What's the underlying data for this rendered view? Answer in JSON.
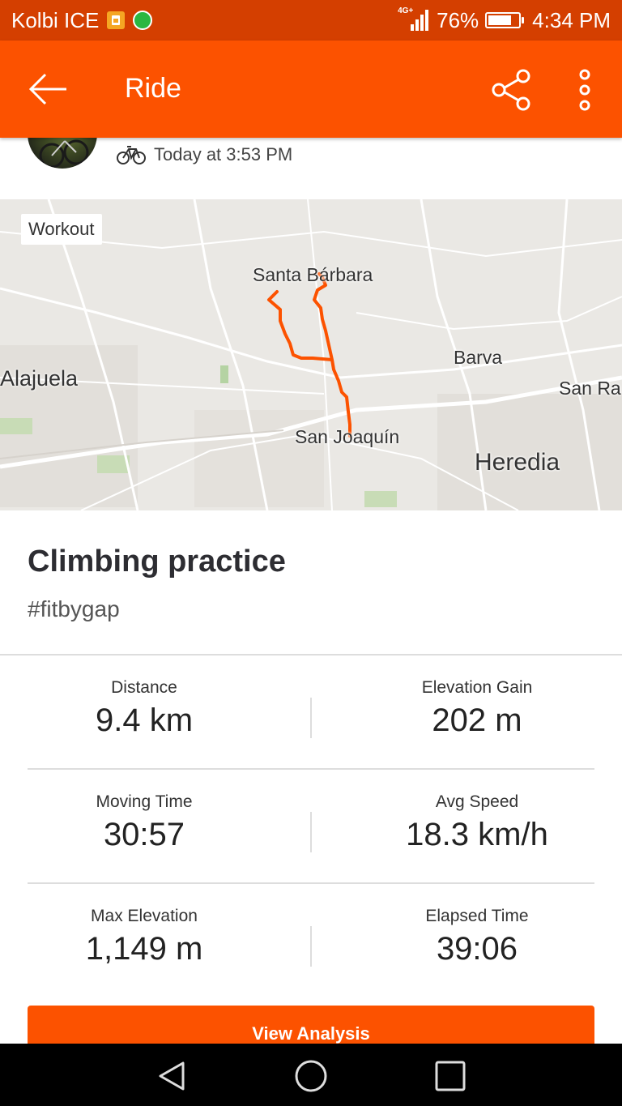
{
  "status_bar": {
    "carrier": "Kolbi ICE",
    "network": "4G+",
    "battery": "76%",
    "battery_level": 0.76,
    "time": "4:34 PM",
    "icons": [
      "sim-icon",
      "whatsapp-icon",
      "signal-icon",
      "battery-icon"
    ]
  },
  "app_bar": {
    "title": "Ride",
    "colors": {
      "background": "#fc5200",
      "status": "#d43f00"
    }
  },
  "activity": {
    "type_icon": "bicycle-icon",
    "datetime": "Today at 3:53 PM",
    "title": "Climbing practice",
    "description": "#fitbygap"
  },
  "map": {
    "badge": "Workout",
    "labels": [
      "Santa Bárbara",
      "Alajuela",
      "Barva",
      "San Ra",
      "San Joaquín",
      "Heredia"
    ],
    "route_color": "#fc5200"
  },
  "stats": [
    [
      {
        "label": "Distance",
        "value": "9.4 km"
      },
      {
        "label": "Elevation Gain",
        "value": "202 m"
      }
    ],
    [
      {
        "label": "Moving Time",
        "value": "30:57"
      },
      {
        "label": "Avg Speed",
        "value": "18.3 km/h"
      }
    ],
    [
      {
        "label": "Max Elevation",
        "value": "1,149 m"
      },
      {
        "label": "Elapsed Time",
        "value": "39:06"
      }
    ]
  ],
  "actions": {
    "view_analysis": "View Analysis"
  }
}
